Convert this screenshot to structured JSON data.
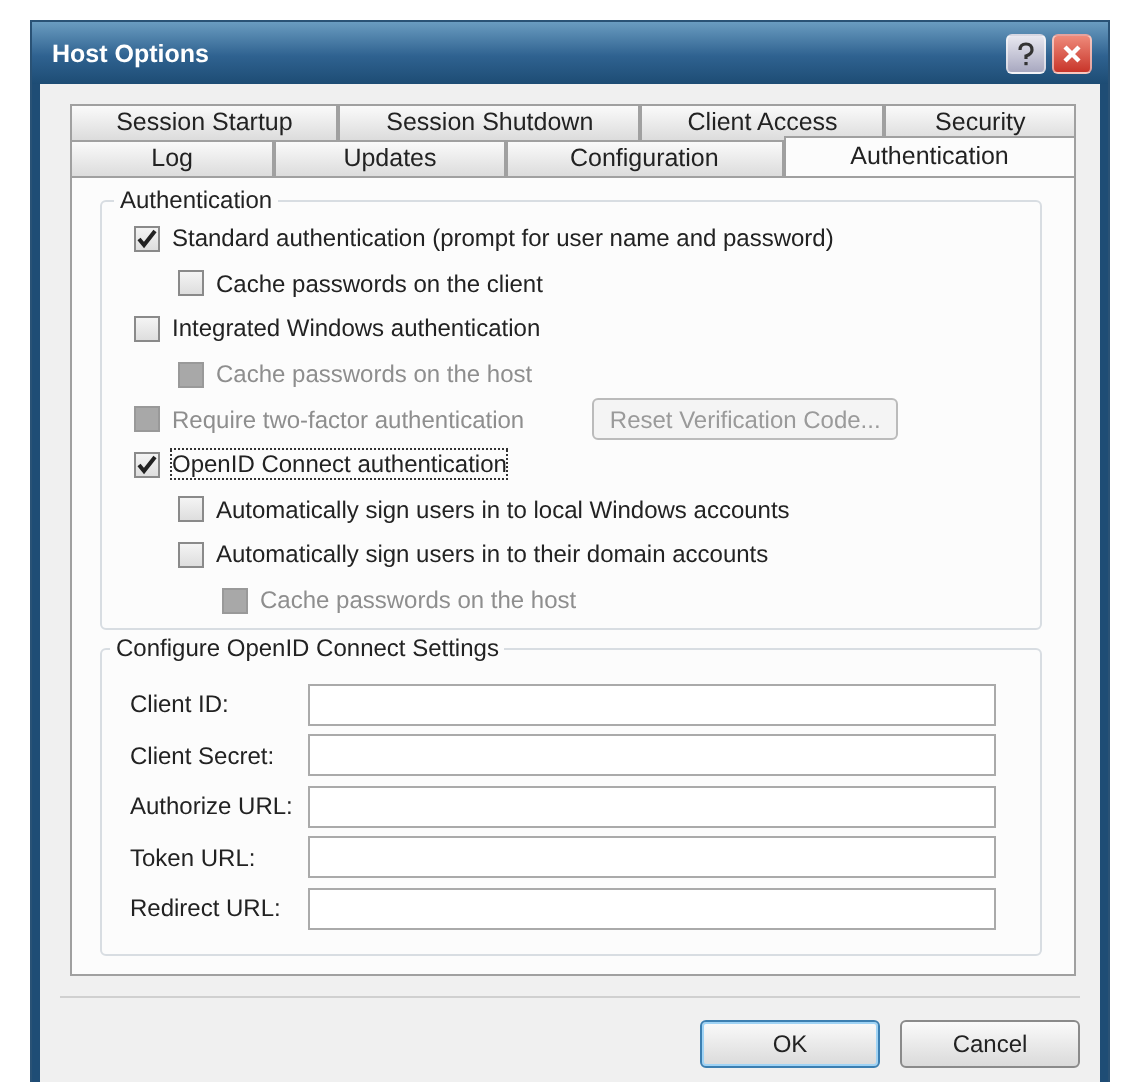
{
  "window": {
    "title": "Host Options"
  },
  "tab_rows": [
    [
      {
        "label": "Session Startup",
        "selected": false
      },
      {
        "label": "Session Shutdown",
        "selected": false
      },
      {
        "label": "Client Access",
        "selected": false
      },
      {
        "label": "Security",
        "selected": false
      }
    ],
    [
      {
        "label": "Log",
        "selected": false
      },
      {
        "label": "Updates",
        "selected": false
      },
      {
        "label": "Configuration",
        "selected": false
      },
      {
        "label": "Authentication",
        "selected": true
      }
    ]
  ],
  "authentication": {
    "title": "Authentication",
    "options": [
      {
        "label": "Standard authentication (prompt for user name and password)",
        "checked": true,
        "disabled": false,
        "focused": false,
        "children": [
          {
            "label": "Cache passwords on the client",
            "checked": false,
            "disabled": false,
            "focused": false
          }
        ]
      },
      {
        "label": "Integrated Windows authentication",
        "checked": false,
        "disabled": false,
        "focused": false,
        "children": [
          {
            "label": "Cache passwords on the host",
            "checked": false,
            "disabled": true,
            "focused": false
          }
        ]
      },
      {
        "label": "Require two-factor authentication",
        "checked": false,
        "disabled": true,
        "focused": false,
        "button": {
          "label": "Reset Verification Code...",
          "disabled": true
        }
      },
      {
        "label": "OpenID Connect authentication",
        "checked": true,
        "disabled": false,
        "focused": true,
        "children": [
          {
            "label": "Automatically sign users in to local Windows accounts",
            "checked": false,
            "disabled": false,
            "focused": false
          },
          {
            "label": "Automatically sign users in to their domain accounts",
            "checked": false,
            "disabled": false,
            "focused": false,
            "children": [
              {
                "label": "Cache passwords on the host",
                "checked": false,
                "disabled": true,
                "focused": false
              }
            ]
          }
        ]
      }
    ]
  },
  "openid_settings": {
    "title": "Configure OpenID Connect Settings",
    "fields": [
      {
        "label": "Client ID:"
      },
      {
        "label": "Client Secret:"
      },
      {
        "label": "Authorize URL:"
      },
      {
        "label": "Token URL:"
      },
      {
        "label": "Redirect URL:"
      }
    ]
  },
  "buttons": [
    {
      "label": "OK",
      "default": true
    },
    {
      "label": "Cancel",
      "default": false
    }
  ]
}
